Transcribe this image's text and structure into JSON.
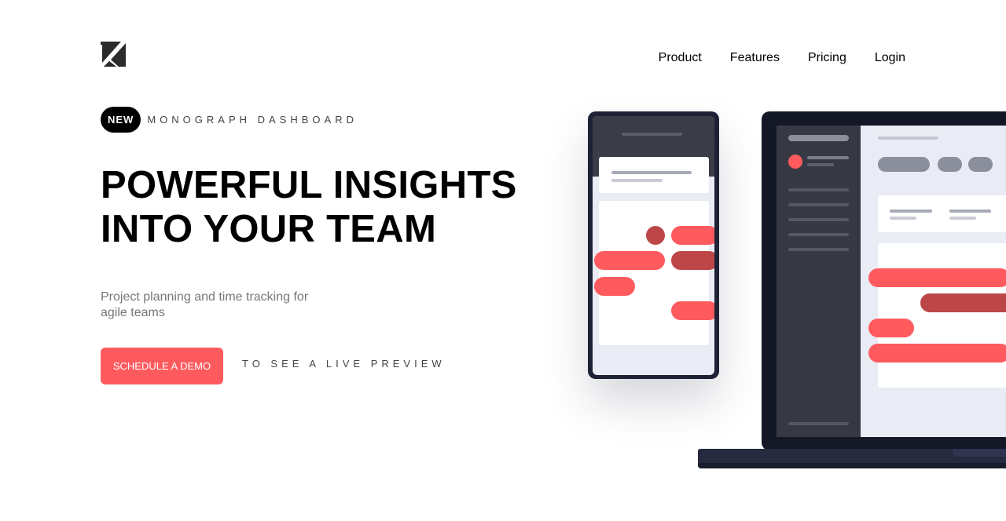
{
  "nav": {
    "items": [
      {
        "label": "Product"
      },
      {
        "label": "Features"
      },
      {
        "label": "Pricing"
      },
      {
        "label": "Login"
      }
    ]
  },
  "hero": {
    "badge": "NEW",
    "eyebrow": "MONOGRAPH DASHBOARD",
    "headline_line1": "POWERFUL INSIGHTS",
    "headline_line2": "INTO YOUR TEAM",
    "subtitle": "Project planning and time tracking for agile teams",
    "cta_label": "SCHEDULE A DEMO",
    "cta_note": "TO SEE A LIVE PREVIEW"
  },
  "colors": {
    "accent": "#ff5b5f",
    "accent_dark": "#bd4748",
    "device_frame": "#1f2235",
    "sidebar": "#363943",
    "screen_bg": "#e9ecf4"
  },
  "icons": {
    "logo": "monograph-logo-icon"
  }
}
